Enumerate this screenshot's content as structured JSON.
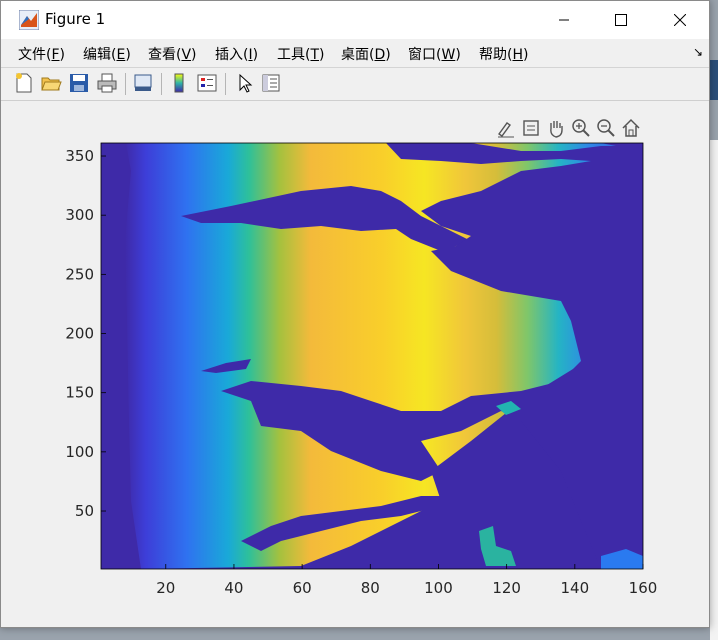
{
  "window": {
    "title": "Figure 1"
  },
  "menu": [
    {
      "label": "文件(",
      "key": "F",
      "end": ")"
    },
    {
      "label": "编辑(",
      "key": "E",
      "end": ")"
    },
    {
      "label": "查看(",
      "key": "V",
      "end": ")"
    },
    {
      "label": "插入(",
      "key": "I",
      "end": ")"
    },
    {
      "label": "工具(",
      "key": "T",
      "end": ")"
    },
    {
      "label": "桌面(",
      "key": "D",
      "end": ")"
    },
    {
      "label": "窗口(",
      "key": "W",
      "end": ")"
    },
    {
      "label": "帮助(",
      "key": "H",
      "end": ")"
    }
  ],
  "toolbar_icons": [
    "new-figure-icon",
    "open-file-icon",
    "save-icon",
    "print-icon",
    "link-plot-icon",
    "colorbar-icon",
    "legend-icon",
    "select-arrow-icon",
    "property-editor-icon"
  ],
  "axes_toolbar_icons": [
    "brush-icon",
    "data-tips-icon",
    "pan-hand-icon",
    "zoom-in-icon",
    "zoom-out-icon",
    "home-icon"
  ],
  "chart_data": {
    "type": "heatmap",
    "colormap": "parula",
    "x_ticks": [
      "20",
      "40",
      "60",
      "80",
      "100",
      "120",
      "140",
      "160"
    ],
    "y_ticks": [
      "50",
      "100",
      "150",
      "200",
      "250",
      "300",
      "350"
    ],
    "xlim": [
      1,
      160
    ],
    "ylim": [
      1,
      361
    ],
    "grid": false,
    "description_of_values": "Low values (dark blue) at left edge and right region; values rise to yellow peak around x 60-90; dark blue intrusions at y≈300, y≈150, y≈70."
  }
}
